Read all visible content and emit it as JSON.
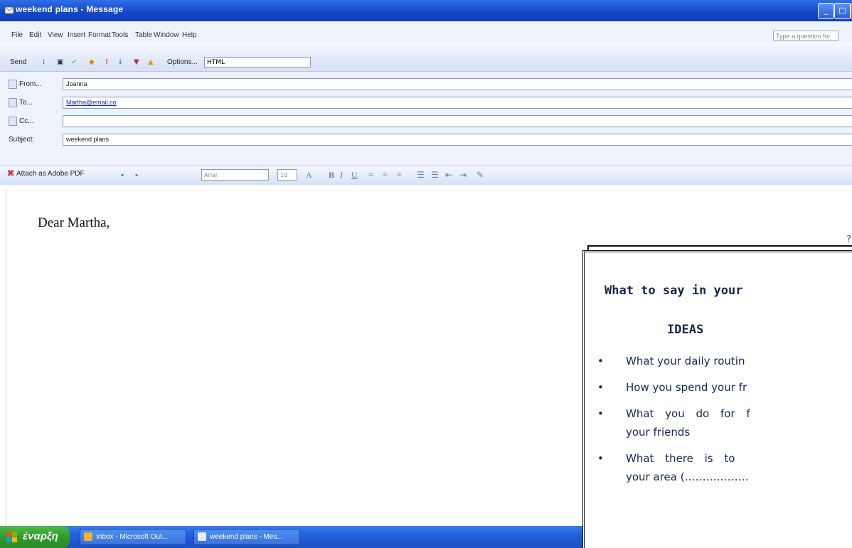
{
  "window": {
    "title": "weekend plans - Message",
    "controls": [
      "_",
      "□",
      "×"
    ]
  },
  "menubar": {
    "items": [
      "File",
      "Edit",
      "View",
      "Insert",
      "Format",
      "Tools",
      "Table",
      "Window",
      "Help"
    ],
    "help_placeholder": "Type a question for help"
  },
  "toolbar": {
    "send_label": "Send",
    "options_label": "Options...",
    "format_value": "HTML"
  },
  "header": {
    "from_label": "From...",
    "from_value": "Joanna",
    "to_label": "To...",
    "to_value": "Martha@email.co",
    "cc_label": "Cc...",
    "cc_value": "",
    "subject_label": "Subject:",
    "subject_value": "weekend plans"
  },
  "formatting": {
    "attach_pdf_label": "Attach as Adobe PDF",
    "font_value": "Arial",
    "size_value": "10"
  },
  "message": {
    "greeting": "Dear Martha,"
  },
  "ideas_panel": {
    "heading": "What to say in your",
    "title": "IDEAS",
    "items": [
      "What your daily routin",
      "How you spend your fr",
      "What you do for f",
      "your friends",
      "What there is to",
      "your area (………………"
    ]
  },
  "taskbar": {
    "start_label": "έναρξη",
    "tasks": [
      "Inbox - Microsoft Out...",
      "weekend plans - Mes..."
    ]
  },
  "colors": {
    "titlebar": "#1548c8",
    "taskbar": "#245edb",
    "start_button": "#2f9a2b",
    "ideas_text": "#15285a"
  }
}
